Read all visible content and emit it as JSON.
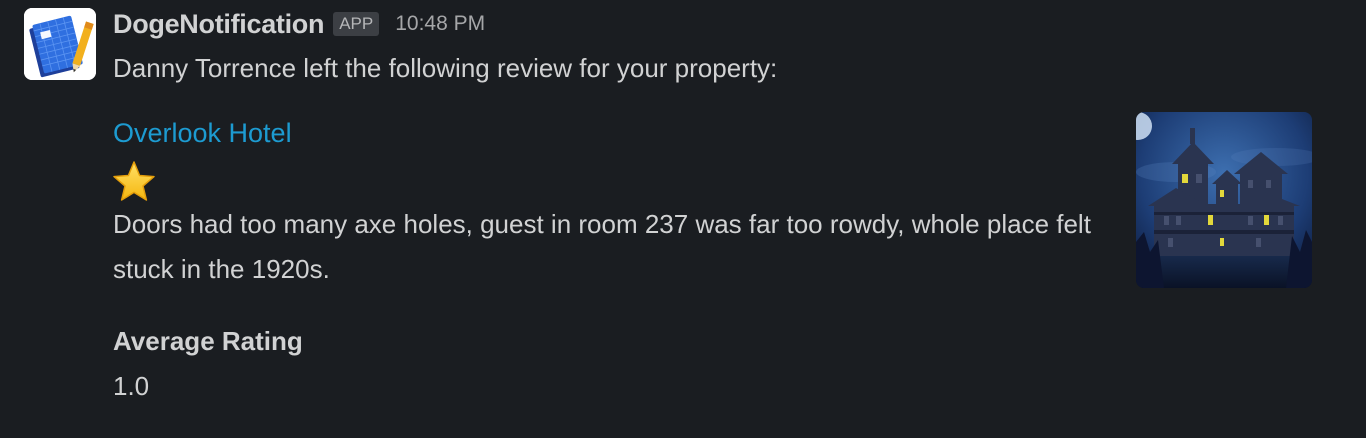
{
  "message": {
    "sender": "DogeNotification",
    "badge": "APP",
    "timestamp": "10:48 PM",
    "intro": "Danny Torrence left the following review for your property:",
    "property_name": "Overlook Hotel",
    "rating_icon": "star-icon",
    "rating_stars": 1,
    "review": "Doors had too many axe holes, guest in room 237 was far too rowdy, whole place felt stuck in the 1920s.",
    "average_label": "Average Rating",
    "average_value": "1.0",
    "thumbnail_icon": "haunted-house-image"
  },
  "colors": {
    "background": "#1a1d21",
    "text": "#d1d2d3",
    "muted": "#a5a6a8",
    "link": "#1d9bd1",
    "badge_bg": "#3c3f44",
    "star": "#f5c518"
  }
}
